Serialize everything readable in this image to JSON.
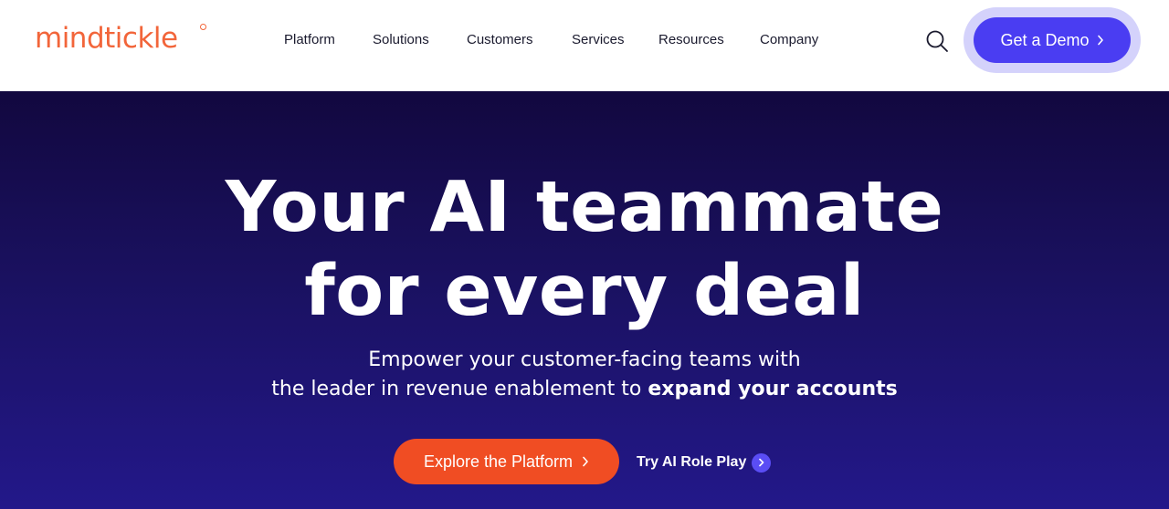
{
  "brand": {
    "name": "mindtickle",
    "color": "#f2653a"
  },
  "nav": {
    "items": [
      "Platform",
      "Solutions",
      "Customers",
      "Services",
      "Resources",
      "Company"
    ]
  },
  "header": {
    "search_icon": "search-icon",
    "demo_label": "Get a Demo",
    "demo_color": "#4a3df2"
  },
  "hero": {
    "headline_line1": "Your AI teammate",
    "headline_line2": "for every deal",
    "sub_line1": "Empower your customer-facing teams with",
    "sub_line2_plain": "the leader in revenue enablement to",
    "sub_line2_bold": "expand your accounts",
    "primary_cta": "Explore the Platform",
    "primary_color": "#f04d23",
    "secondary_cta": "Try AI Role Play",
    "background": "#1a1160"
  }
}
